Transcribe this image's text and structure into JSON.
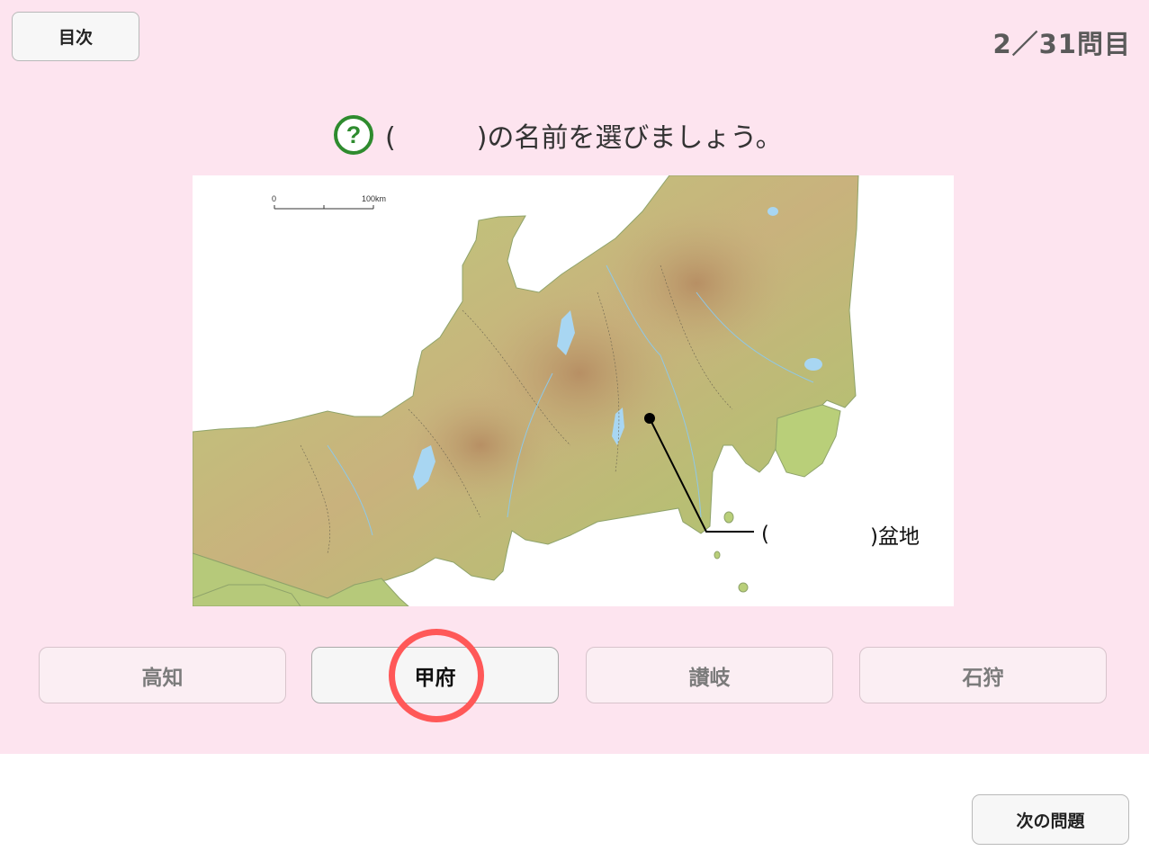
{
  "header": {
    "toc_label": "目次",
    "progress": "2／31問目"
  },
  "question": {
    "icon": "question-circle-icon",
    "text": "(　　　)の名前を選びましょう。"
  },
  "map": {
    "scale_start": "0",
    "scale_end": "100km",
    "callout_open": "(",
    "callout_close": ")盆地"
  },
  "choices": [
    {
      "label": "高知",
      "selected": false
    },
    {
      "label": "甲府",
      "selected": true
    },
    {
      "label": "讃岐",
      "selected": false
    },
    {
      "label": "石狩",
      "selected": false
    }
  ],
  "footer": {
    "next_label": "次の問題"
  },
  "colors": {
    "panel_bg": "#fde4ef",
    "answer_mark": "#ff5858",
    "icon_green": "#2e8b2e"
  }
}
